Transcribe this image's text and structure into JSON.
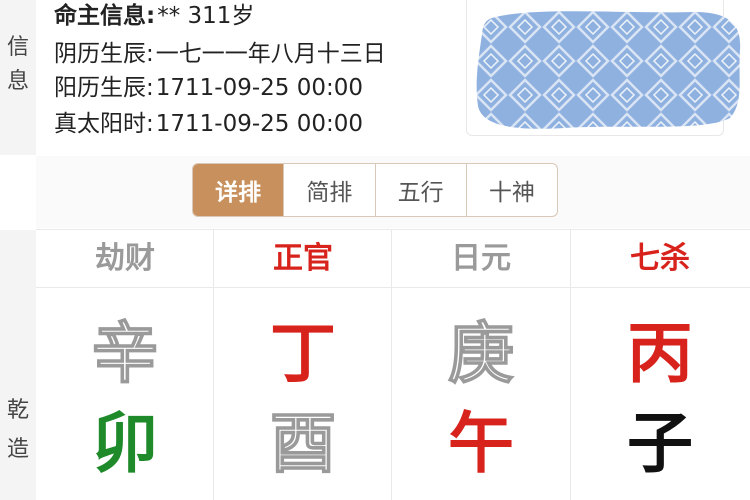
{
  "side": {
    "info_label": [
      "信",
      "息"
    ],
    "qianzao_label": [
      "乾",
      "造"
    ]
  },
  "info": {
    "owner_key": "命主信息:",
    "owner_value": "** 311岁",
    "lunar_key": "阴历生辰:",
    "lunar_value": "一七一一年八月十三日",
    "solar_key": "阳历生辰:",
    "solar_value": "1711-09-25 00:00",
    "true_solar_key": "真太阳时:",
    "true_solar_value": "1711-09-25 00:00"
  },
  "tabs": [
    {
      "label": "详排",
      "active": true
    },
    {
      "label": "简排",
      "active": false
    },
    {
      "label": "五行",
      "active": false
    },
    {
      "label": "十神",
      "active": false
    }
  ],
  "columns": [
    {
      "heading": "劫财",
      "gan": "辛",
      "zhi": "卯"
    },
    {
      "heading": "正官",
      "gan": "丁",
      "zhi": "酉"
    },
    {
      "heading": "日元",
      "gan": "庚",
      "zhi": "午"
    },
    {
      "heading": "七杀",
      "gan": "丙",
      "zhi": "子"
    }
  ],
  "colors": {
    "accent": "#c8905c",
    "red": "#d8231c",
    "green": "#1f8a2a",
    "gray": "#9a9a9a",
    "redaction_blue": "#8fb1e0"
  }
}
